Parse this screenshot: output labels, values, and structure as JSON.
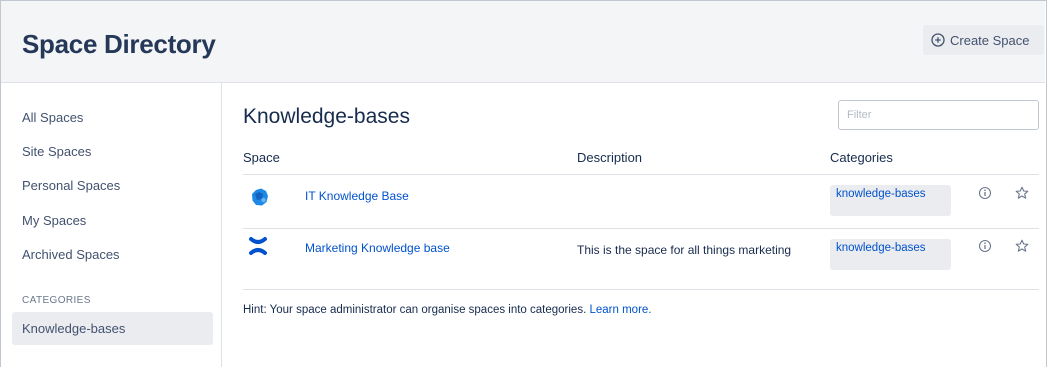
{
  "header": {
    "title": "Space Directory",
    "create_label": "Create Space"
  },
  "sidebar": {
    "items": [
      {
        "label": "All Spaces"
      },
      {
        "label": "Site Spaces"
      },
      {
        "label": "Personal Spaces"
      },
      {
        "label": "My Spaces"
      },
      {
        "label": "Archived Spaces"
      }
    ],
    "categories_label": "CATEGORIES",
    "selected_category": "Knowledge-bases"
  },
  "main": {
    "title": "Knowledge-bases",
    "filter_placeholder": "Filter",
    "columns": {
      "space": "Space",
      "description": "Description",
      "categories": "Categories"
    },
    "rows": [
      {
        "name": "IT Knowledge Base",
        "description": "",
        "category": "knowledge-bases",
        "icon": "it-space-icon"
      },
      {
        "name": "Marketing Knowledge base",
        "description": "This is the space for all things marketing",
        "category": "knowledge-bases",
        "icon": "marketing-space-icon"
      }
    ],
    "hint_text": "Hint: Your space administrator can organise spaces into categories.",
    "hint_link": "Learn more."
  },
  "colors": {
    "link": "#0052cc",
    "header_bg": "#f4f5f7",
    "tag_bg": "#ebecf0",
    "text": "#172b4d"
  }
}
